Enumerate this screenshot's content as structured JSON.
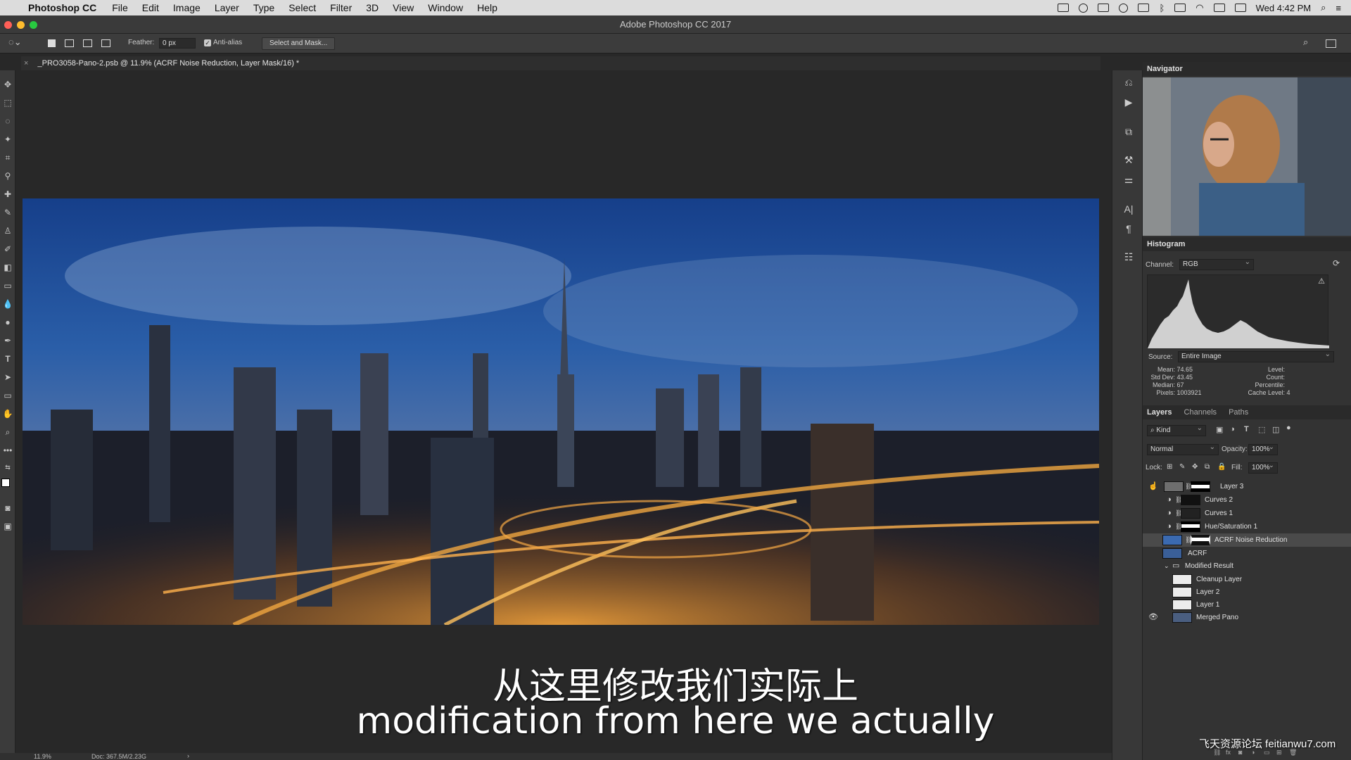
{
  "menubar": {
    "apple": "",
    "app": "Photoshop CC",
    "items": [
      "File",
      "Edit",
      "Image",
      "Layer",
      "Type",
      "Select",
      "Filter",
      "3D",
      "View",
      "Window",
      "Help"
    ],
    "clock": "Wed 4:42 PM"
  },
  "window": {
    "title": "Adobe Photoshop CC 2017"
  },
  "options": {
    "feather_label": "Feather:",
    "feather_value": "0 px",
    "antialias_label": "Anti-alias",
    "select_mask_label": "Select and Mask..."
  },
  "document": {
    "tab_title": "_PRO3058-Pano-2.psb @ 11.9% (ACRF Noise Reduction, Layer Mask/16) *",
    "zoom": "11.9%",
    "doc_size": "Doc: 367.5M/2.23G"
  },
  "subtitles": {
    "chinese": "从这里修改我们实际上",
    "english": "modification from here we actually"
  },
  "watermark": "飞天资源论坛 feitianwu7.com",
  "navigator": {
    "title": "Navigator"
  },
  "histogram": {
    "title": "Histogram",
    "channel_label": "Channel:",
    "channel_value": "RGB",
    "source_label": "Source:",
    "source_value": "Entire Image",
    "stats_left": [
      {
        "label": "Mean:",
        "value": "74.65"
      },
      {
        "label": "Std Dev:",
        "value": "43.45"
      },
      {
        "label": "Median:",
        "value": "67"
      },
      {
        "label": "Pixels:",
        "value": "1003921"
      }
    ],
    "stats_right": [
      {
        "label": "Level:",
        "value": ""
      },
      {
        "label": "Count:",
        "value": ""
      },
      {
        "label": "Percentile:",
        "value": ""
      },
      {
        "label": "Cache Level:",
        "value": "4"
      }
    ]
  },
  "layers_panel": {
    "tabs": [
      "Layers",
      "Channels",
      "Paths"
    ],
    "filter_kind": "Kind",
    "blend_mode": "Normal",
    "opacity_label": "Opacity:",
    "opacity_value": "100%",
    "lock_label": "Lock:",
    "fill_label": "Fill:",
    "fill_value": "100%",
    "layers": [
      {
        "name": "Layer 3"
      },
      {
        "name": "Curves 2"
      },
      {
        "name": "Curves 1"
      },
      {
        "name": "Hue/Saturation 1"
      },
      {
        "name": "ACRF Noise Reduction"
      },
      {
        "name": "ACRF"
      },
      {
        "name": "Modified Result"
      },
      {
        "name": "Cleanup Layer"
      },
      {
        "name": "Layer 2"
      },
      {
        "name": "Layer 1"
      },
      {
        "name": "Merged Pano"
      }
    ]
  },
  "colors": {
    "accent_selected_row": "#4a4a4a",
    "panel_bg": "#333333",
    "canvas_bg": "#282828"
  }
}
